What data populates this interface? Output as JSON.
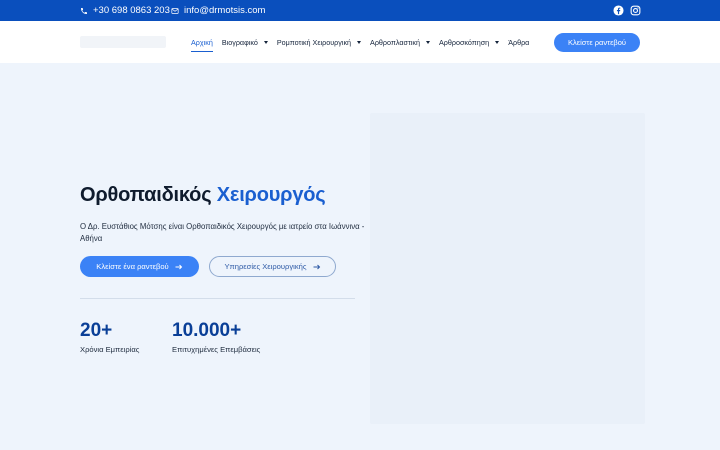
{
  "topbar": {
    "phone": "+30 698 0863 203",
    "email": "info@drmotsis.com",
    "phone_icon": "phone-icon",
    "email_icon": "envelope-icon",
    "social": [
      "facebook-icon",
      "instagram-icon"
    ]
  },
  "nav": {
    "items": [
      {
        "label": "Αρχική",
        "active": true,
        "dropdown": false
      },
      {
        "label": "Βιογραφικό",
        "active": false,
        "dropdown": true
      },
      {
        "label": "Ρομποτική Χειρουργική",
        "active": false,
        "dropdown": true
      },
      {
        "label": "Αρθροπλαστική",
        "active": false,
        "dropdown": true
      },
      {
        "label": "Αρθροσκόπηση",
        "active": false,
        "dropdown": true
      },
      {
        "label": "Άρθρα",
        "active": false,
        "dropdown": false
      }
    ],
    "cta": "Κλείστε ραντεβού"
  },
  "hero": {
    "title_plain": "Ορθοπαιδικός",
    "title_accent": "Χειρουργός",
    "description": "Ο Δρ. Ευστάθιος Μότσης είναι Ορθοπαιδικός Χειρουργός με ιατρείο στα Ιωάννινα - Αθήνα",
    "primary_button": "Κλείστε ένα ραντεβού",
    "secondary_button": "Υπηρεσίες Χειρουργικής"
  },
  "stats": [
    {
      "value": "20+",
      "label": "Χρόνια Εμπειρίας"
    },
    {
      "value": "10.000+",
      "label": "Επιτυχημένες Επεμβάσεις"
    }
  ],
  "colors": {
    "brand_dark": "#0a4fbd",
    "accent": "#3b82f6",
    "background": "#eef4fc"
  }
}
